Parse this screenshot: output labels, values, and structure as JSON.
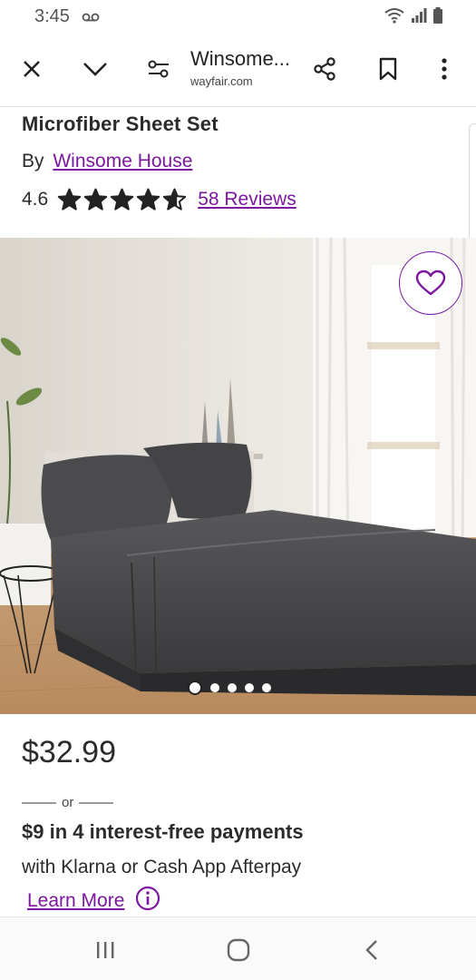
{
  "status_bar": {
    "time": "3:45",
    "icons": [
      "voicemail-icon",
      "wifi-icon",
      "signal-icon",
      "battery-icon"
    ]
  },
  "browser": {
    "page_title": "Winsome...",
    "domain": "wayfair.com",
    "icons": [
      "close-icon",
      "chevron-down-icon",
      "page-settings-icon",
      "share-icon",
      "bookmark-icon",
      "more-vertical-icon"
    ]
  },
  "product": {
    "title": "Microfiber Sheet Set",
    "by_label": "By",
    "brand": "Winsome House",
    "rating": "4.6",
    "rating_value": 4.6,
    "rating_max": 5,
    "reviews_label": "58 Reviews"
  },
  "gallery": {
    "image_count": 5,
    "active_index": 0,
    "favorite_icon": "heart-icon"
  },
  "pricing": {
    "price": "$32.99",
    "or_label": "or",
    "installments": "$9 in 4 interest-free payments",
    "provider_text": "with Klarna or Cash App Afterpay",
    "learn_more": "Learn More"
  },
  "nav_bar": {
    "icons": [
      "recent-apps-icon",
      "home-icon",
      "back-icon"
    ]
  },
  "colors": {
    "accent": "#7b189f",
    "text": "#2b2b2b"
  }
}
